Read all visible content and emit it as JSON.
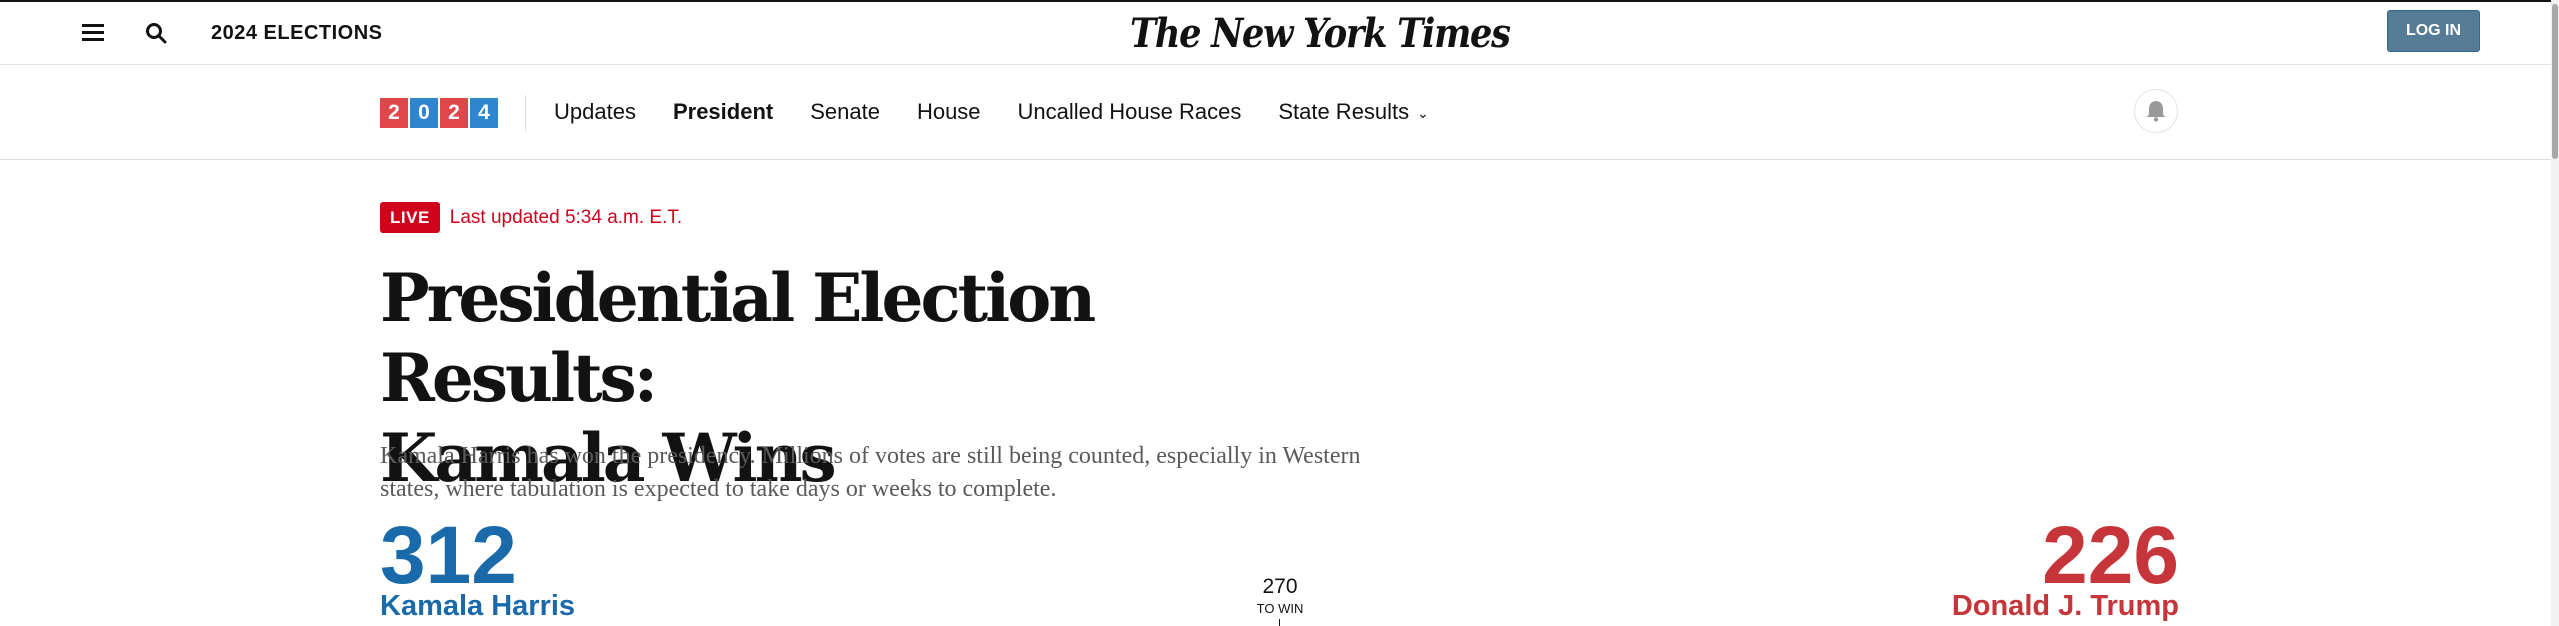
{
  "header": {
    "section_title": "2024 ELECTIONS",
    "logo_text": "The New York Times",
    "login_label": "LOG IN"
  },
  "subnav": {
    "year_digits": [
      "2",
      "0",
      "2",
      "4"
    ],
    "links": [
      {
        "label": "Updates",
        "active": false
      },
      {
        "label": "President",
        "active": true
      },
      {
        "label": "Senate",
        "active": false
      },
      {
        "label": "House",
        "active": false
      },
      {
        "label": "Uncalled House Races",
        "active": false
      },
      {
        "label": "State Results",
        "active": false,
        "has_dropdown": true
      }
    ]
  },
  "status": {
    "live_label": "LIVE",
    "updated_text": "Last updated 5:34 a.m. E.T."
  },
  "article": {
    "headline_line1": "Presidential Election Results:",
    "headline_line2": "Kamala Wins",
    "dek": "Kamala Harris has won the presidency. Millions of votes are still being counted, especially in Western states, where tabulation is expected to take days or weeks to complete."
  },
  "results": {
    "harris": {
      "votes": "312",
      "name": "Kamala Harris",
      "color": "#1a6aab"
    },
    "trump": {
      "votes": "226",
      "name": "Donald J. Trump",
      "color": "#c5353a"
    },
    "to_win_number": "270",
    "to_win_label": "TO WIN"
  },
  "icons": [
    "menu-icon",
    "search-icon",
    "bell-icon",
    "chevron-down-icon"
  ]
}
